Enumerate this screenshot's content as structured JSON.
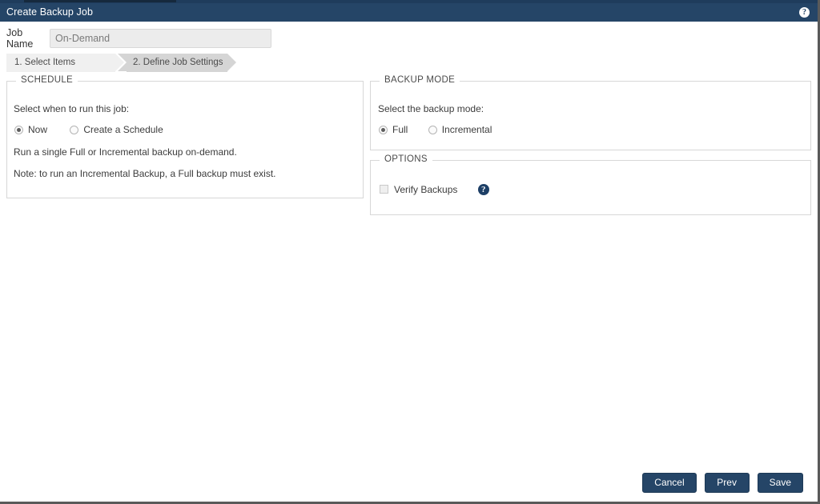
{
  "window": {
    "title": "Create Backup Job",
    "help_icon": "help-circle-icon"
  },
  "job_name": {
    "label": "Job Name",
    "value": "On-Demand",
    "placeholder": "On-Demand"
  },
  "steps": [
    {
      "label": "1. Select Items",
      "active": false
    },
    {
      "label": "2. Define Job Settings",
      "active": true
    }
  ],
  "schedule": {
    "legend": "SCHEDULE",
    "prompt": "Select when to run this job:",
    "options": [
      {
        "label": "Now",
        "selected": true
      },
      {
        "label": "Create a Schedule",
        "selected": false
      }
    ],
    "description": "Run a single Full or Incremental backup on-demand.",
    "note": "Note: to run an Incremental Backup, a Full backup must exist."
  },
  "backup_mode": {
    "legend": "BACKUP MODE",
    "prompt": "Select the backup mode:",
    "options": [
      {
        "label": "Full",
        "selected": true
      },
      {
        "label": "Incremental",
        "selected": false
      }
    ]
  },
  "options": {
    "legend": "OPTIONS",
    "verify_backups_label": "Verify Backups",
    "verify_backups_checked": false,
    "help_icon": "help-circle-icon"
  },
  "footer": {
    "cancel_label": "Cancel",
    "prev_label": "Prev",
    "save_label": "Save"
  },
  "colors": {
    "titlebar": "#254567",
    "button": "#254567",
    "step_active": "#d5d5d5",
    "step_inactive": "#f0f0f0",
    "panel_border": "#d7d7d7",
    "input_background": "#ececec",
    "help_icon": "#1d3f66"
  }
}
